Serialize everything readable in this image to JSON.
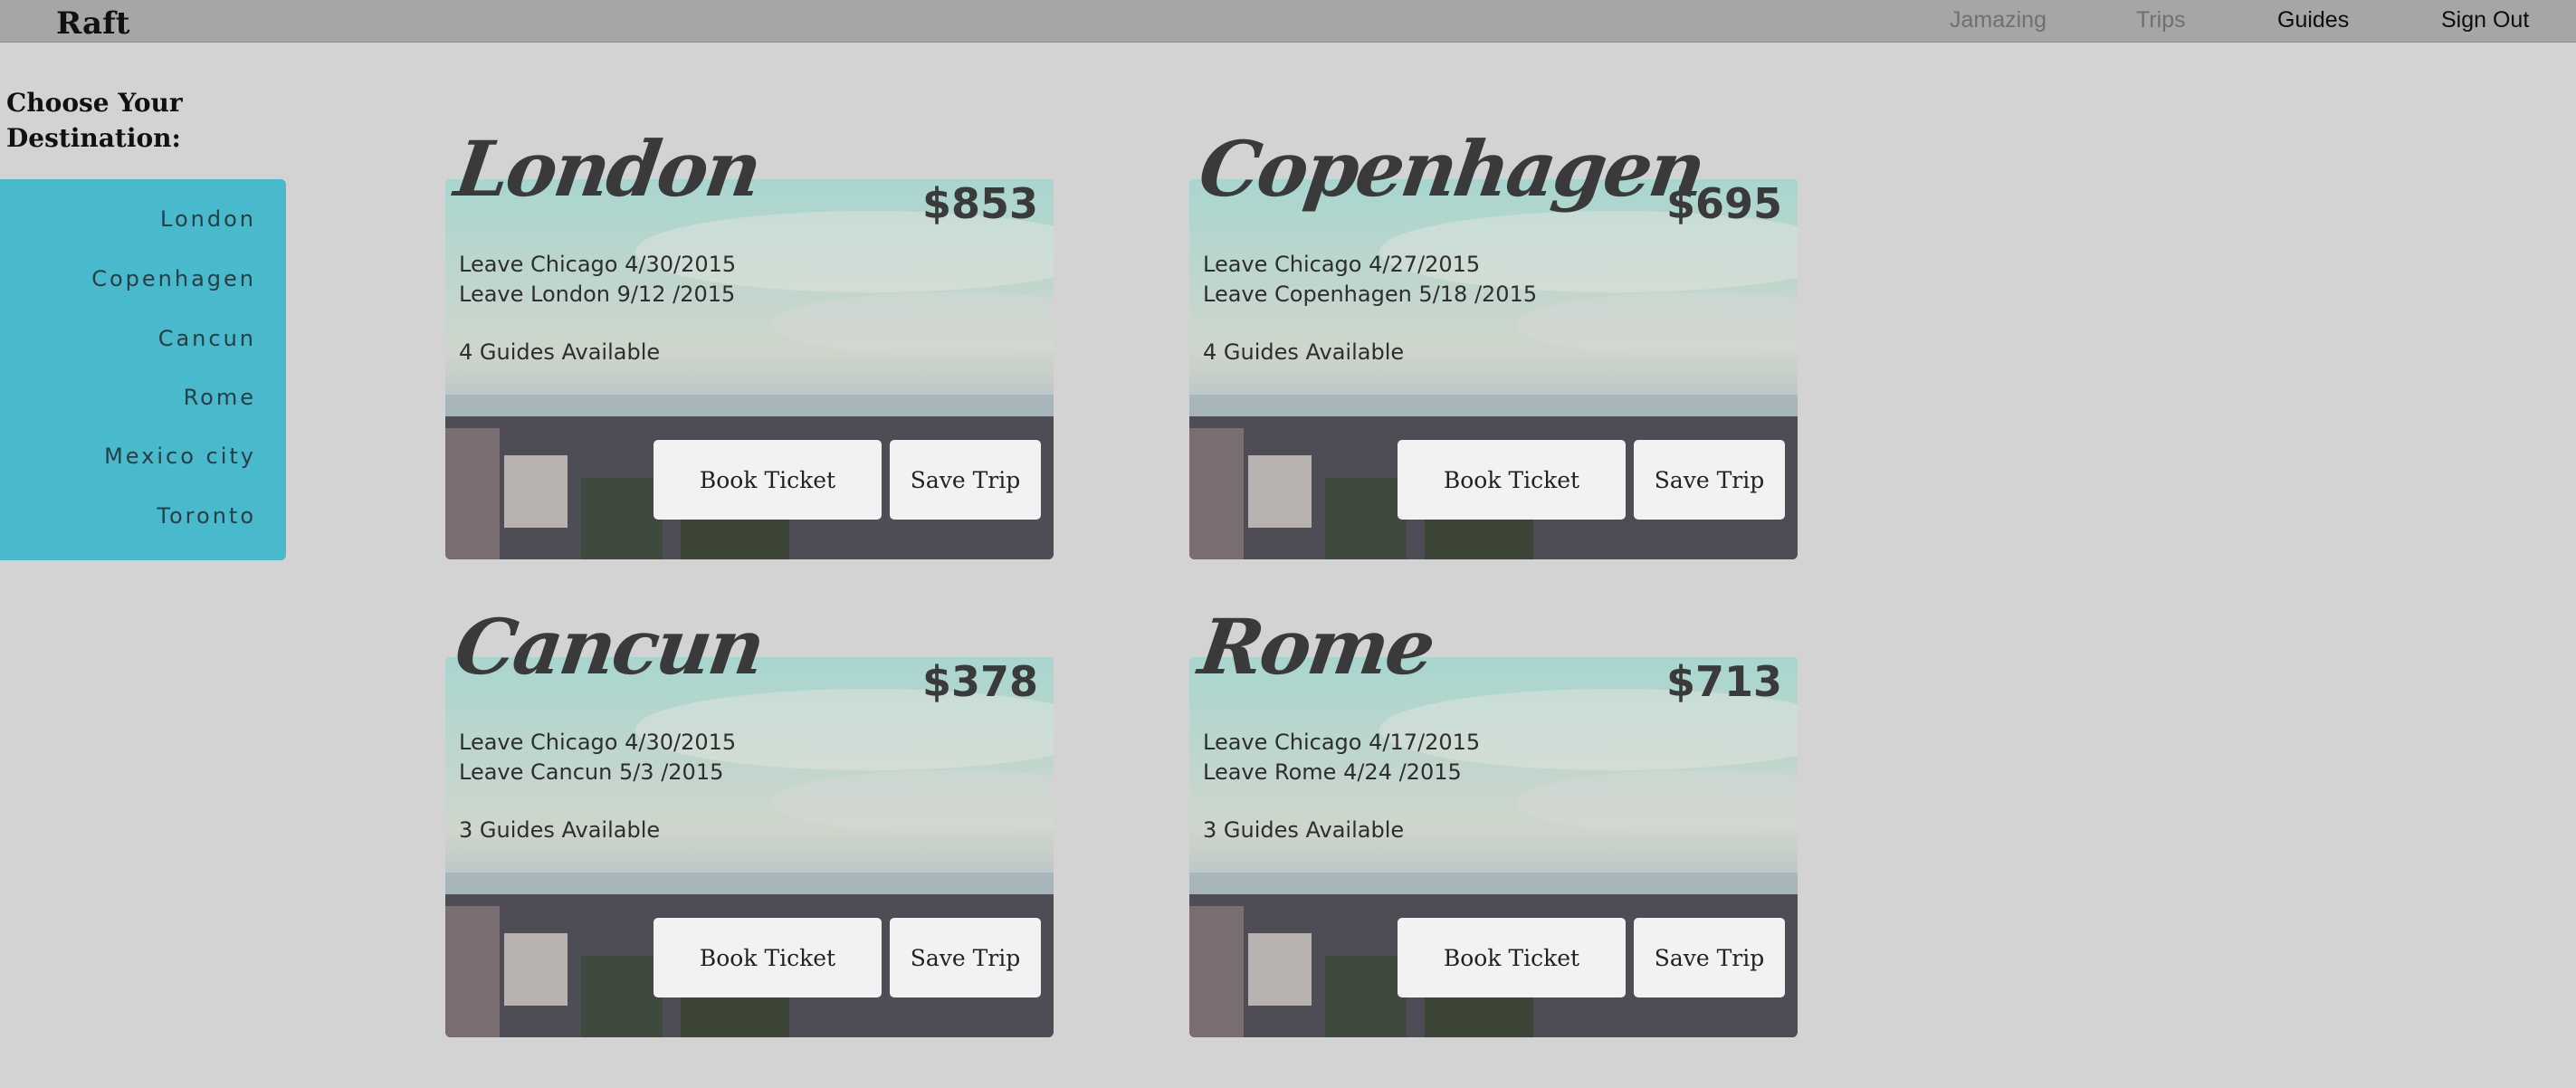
{
  "header": {
    "brand": "Raft",
    "nav": [
      "Jamazing",
      "Trips",
      "Guides",
      "Sign Out"
    ]
  },
  "sidebar": {
    "title": "Choose Your Destination:",
    "items": [
      "London",
      "Copenhagen",
      "Cancun",
      "Rome",
      "Mexico city",
      "Toronto"
    ]
  },
  "cards": [
    {
      "city": "London",
      "price": "$853",
      "leave1": "Leave Chicago 4/30/2015",
      "leave2": "Leave London 9/12 /2015",
      "guides": "4 Guides Available",
      "book": "Book Ticket",
      "save": "Save Trip"
    },
    {
      "city": "Copenhagen",
      "price": "$695",
      "leave1": "Leave Chicago 4/27/2015",
      "leave2": "Leave Copenhagen 5/18 /2015",
      "guides": "4 Guides Available",
      "book": "Book Ticket",
      "save": "Save Trip"
    },
    {
      "city": "Cancun",
      "price": "$378",
      "leave1": "Leave Chicago 4/30/2015",
      "leave2": "Leave Cancun 5/3 /2015",
      "guides": "3 Guides Available",
      "book": "Book Ticket",
      "save": "Save Trip"
    },
    {
      "city": "Rome",
      "price": "$713",
      "leave1": "Leave Chicago 4/17/2015",
      "leave2": "Leave Rome 4/24 /2015",
      "guides": "3 Guides Available",
      "book": "Book Ticket",
      "save": "Save Trip"
    }
  ],
  "colors": {
    "page_bg": "#d3d3d3",
    "topbar_bg": "#a6a6a6",
    "sidebar_bg": "#49b9cc",
    "button_bg": "#f2f2f2"
  }
}
